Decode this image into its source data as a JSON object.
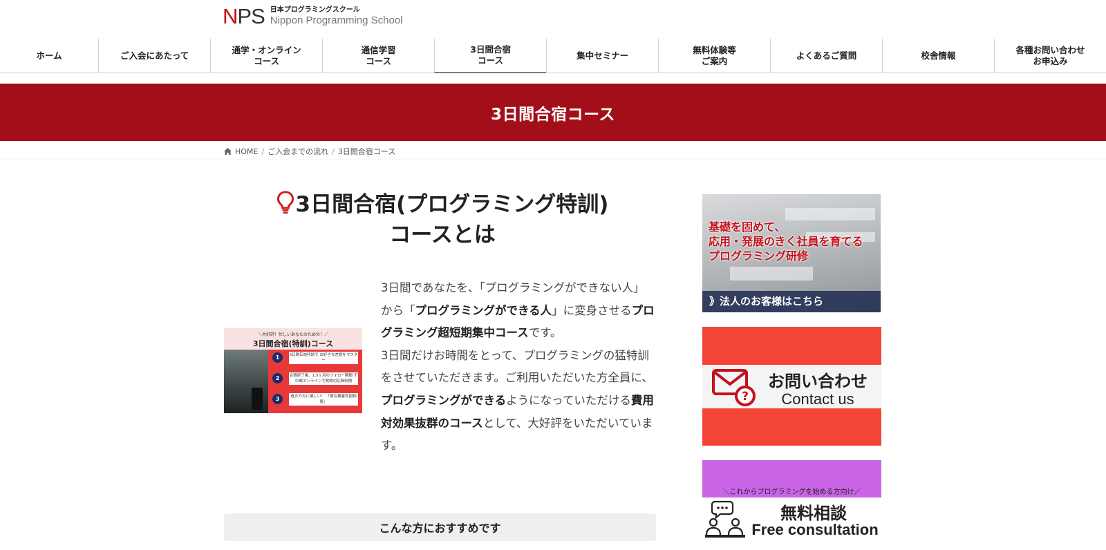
{
  "logo": {
    "mark_n": "N",
    "mark_ps": "PS",
    "jp": "日本プログラミングスクール",
    "en": "Nippon Programming School"
  },
  "nav": {
    "items": [
      {
        "label": "ホーム"
      },
      {
        "label": "ご入会にあたって"
      },
      {
        "label": "通学・オンライン\nコース"
      },
      {
        "label": "通信学習\nコース"
      },
      {
        "label": "3日間合宿\nコース",
        "active": true
      },
      {
        "label": "集中セミナー"
      },
      {
        "label": "無料体験等\nご案内"
      },
      {
        "label": "よくあるご質問"
      },
      {
        "label": "校舎情報"
      },
      {
        "label": "各種お問い合わせ\nお申込み"
      }
    ]
  },
  "banner": {
    "title": "3日間合宿コース"
  },
  "breadcrumb": {
    "home": "HOME",
    "sep": "/",
    "level1": "ご入会までの流れ",
    "current": "3日間合宿コース"
  },
  "main": {
    "heading_line1": "3日間合宿(プログラミング特訓)",
    "heading_line2": "コースとは",
    "thumbnail": {
      "tagline": "＼大好評！忙しいあなたのための！／",
      "title": "3日間合宿(特訓)コース",
      "items": [
        {
          "num": "1",
          "text": "3日間缶詰特訓で お好きな言語をマスター"
        },
        {
          "num": "2",
          "text": "合宿終了後、1.5ヶ月のフォロー期間 その間オンラインで質問対応無制限"
        },
        {
          "num": "3",
          "text": "遠方の方に嬉しい！ 「宿泊費者負担制度」"
        }
      ]
    },
    "intro": {
      "p1_a": "3日間であなたを、「プログラミングができない人」から「",
      "p1_b": "プログラミングができる人",
      "p1_c": "」に変身させる",
      "p1_d": "プログラミング超短期集中コース",
      "p1_e": "です。",
      "p2_a": "3日間だけお時間をとって、プログラミングの猛特訓をさせていただきます。ご利用いただいた方全員に、",
      "p2_b": "プログラミングができる",
      "p2_c": "ようになっていただける",
      "p2_d": "費用対効果抜群のコース",
      "p2_e": "として、大好評をいただいています。"
    },
    "recommend": "こんな方におすすめです"
  },
  "sidebar": {
    "corporate": {
      "line1": "基礎を固めて、",
      "line2": "応用・発展のきく社員を育てる",
      "line3": "プログラミング研修",
      "bar": "》法人のお客様はこちら"
    },
    "contact": {
      "jp": "お問い合わせ",
      "en": "Contact us",
      "color": "#f24537"
    },
    "consult": {
      "top": "＼これからプログラミングを始める方向け／",
      "jp": "無料相談",
      "en": "Free consultation",
      "color": "#c965e6"
    }
  },
  "colors": {
    "brand_red": "#a30f18",
    "logo_red": "#c00d1a"
  }
}
